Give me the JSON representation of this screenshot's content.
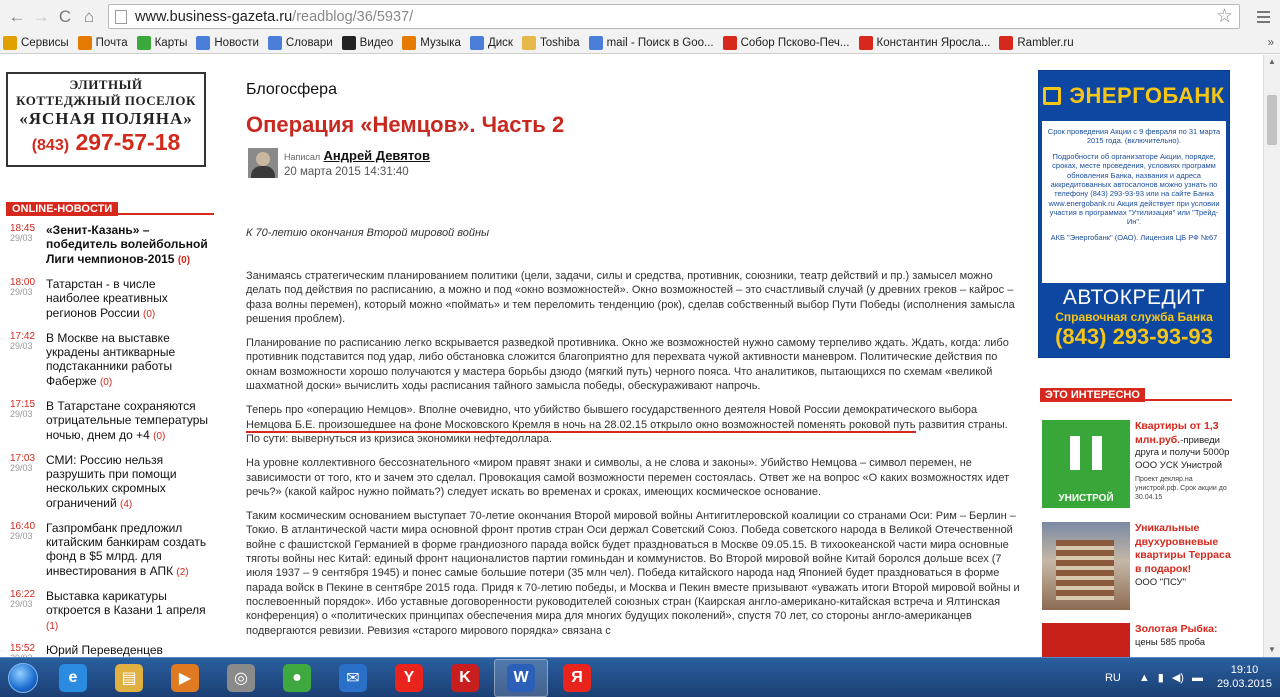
{
  "browser": {
    "url_host": "www.business-gazeta.ru",
    "url_path": "/readblog/36/5937/",
    "bookmarks": [
      {
        "label": "Сервисы",
        "icon": "apps-icon",
        "color": "#e0a000"
      },
      {
        "label": "Почта",
        "icon": "mail-ru-icon",
        "color": "#e57a00"
      },
      {
        "label": "Карты",
        "icon": "maps-icon",
        "color": "#3aa83a"
      },
      {
        "label": "Новости",
        "icon": "page-icon",
        "color": "#4a7ed8"
      },
      {
        "label": "Словари",
        "icon": "page-icon",
        "color": "#4a7ed8"
      },
      {
        "label": "Видео",
        "icon": "video-icon",
        "color": "#222222"
      },
      {
        "label": "Музыка",
        "icon": "music-icon",
        "color": "#e57a00"
      },
      {
        "label": "Диск",
        "icon": "disk-icon",
        "color": "#4a7ed8"
      },
      {
        "label": "Toshiba",
        "icon": "folder-icon",
        "color": "#e6b84a"
      },
      {
        "label": "mail - Поиск в Goo...",
        "icon": "google-icon",
        "color": "#4a7ed8"
      },
      {
        "label": "Собор Псково-Печ...",
        "icon": "yandex-icon",
        "color": "#d6281c"
      },
      {
        "label": "Константин Яросла...",
        "icon": "yandex-icon",
        "color": "#d6281c"
      },
      {
        "label": "Rambler.ru",
        "icon": "yandex-icon",
        "color": "#d6281c"
      }
    ],
    "bookmarks_more": "»"
  },
  "left": {
    "ad": {
      "line1": "ЭЛИТНЫЙ",
      "line2": "КОТТЕДЖНЫЙ ПОСЕЛОК",
      "line3": "«ЯСНАЯ ПОЛЯНА»",
      "phone_code": "(843)",
      "phone": "297-57-18"
    },
    "online_title": "ONLINE-НОВОСТИ",
    "news": [
      {
        "time": "18:45",
        "date": "29/03",
        "text": "«Зенит-Казань» – победитель волейбольной Лиги чемпионов-2015",
        "count": "(0)",
        "bold": true
      },
      {
        "time": "18:00",
        "date": "29/03",
        "text": "Татарстан - в числе наиболее креативных регионов России",
        "count": "(0)"
      },
      {
        "time": "17:42",
        "date": "29/03",
        "text": "В Москве на выставке украдены антикварные подстаканники работы Фаберже",
        "count": "(0)"
      },
      {
        "time": "17:15",
        "date": "29/03",
        "text": "В Татарстане сохраняются отрицательные температуры ночью, днем до +4",
        "count": "(0)"
      },
      {
        "time": "17:03",
        "date": "29/03",
        "text": "СМИ: Россию нельзя разрушить при помощи нескольких скромных ограничений",
        "count": "(4)"
      },
      {
        "time": "16:40",
        "date": "29/03",
        "text": "Газпромбанк предложил китайским банкирам создать фонд в $5 млрд. для инвестирования в АПК",
        "count": "(2)"
      },
      {
        "time": "16:22",
        "date": "29/03",
        "text": "Выставка карикатуры откроется в Казани 1 апреля",
        "count": "(1)"
      },
      {
        "time": "15:52",
        "date": "29/03",
        "text": "Юрий Переведенцев рассказал, чем грозит",
        "count": ""
      }
    ]
  },
  "article": {
    "rubric": "Блогосфера",
    "title": "Операция «Немцов». Часть 2",
    "wrote_label": "Написал",
    "author": "Андрей Девятов",
    "date": "20 марта 2015 14:31:40",
    "epigraph": "К 70-летию окончания Второй мировой войны",
    "p1": "Занимаясь стратегическим планированием политики (цели, задачи, силы и средства, противник, союзники, театр действий и пр.) замысел можно делать под действия по расписанию, а можно и под «окно возможностей». Окно возможностей – это счастливый случай (у древних греков – кайрос – фаза волны перемен), который можно «поймать» и тем переломить тенденцию (рок), сделав собственный выбор Пути Победы (исполнения замысла решения проблем).",
    "p2": "Планирование по расписанию легко вскрывается разведкой противника. Окно же возможностей нужно самому терпеливо ждать. Ждать, когда: либо противник подставится под удар, либо обстановка сложится благоприятно для перехвата чужой активности маневром. Политические действия по окнам возможности хорошо получаются у мастера борьбы дзюдо (мягкий путь) черного пояса. Что аналитиков, пытающихся по схемам «великой шахматной доски» вычислить ходы расписания тайного замысла победы, обескураживают напрочь.",
    "p3a": "Теперь про «операцию Немцов». Вполне очевидно, что убийство бывшего государственного деятеля Новой России демократического выбора ",
    "p3b": "Немцова Б.Е. произошедшее на фоне Московского Кремля в ночь на 28.02.15 открыло окно возможностей поменять роковой путь",
    "p3c": " развития страны. По сути: вывернуться из кризиса экономики нефтедоллара.",
    "p4": "На уровне коллективного бессознательного «миром правят знаки и символы, а не слова и законы». Убийство Немцова – символ перемен, не зависимости от того, кто и зачем это сделал. Провокация самой возможности перемен состоялась. Ответ же на вопрос «О каких возможностях идет речь?» (какой кайрос нужно поймать?) следует искать во временах и сроках, имеющих космическое основание.",
    "p5": "Таким космическим основанием выступает 70-летие окончания Второй мировой войны Антигитлеровской коалиции со странами Оси: Рим – Берлин – Токио. В атлантической части мира основной фронт против стран Оси держал Советский Союз. Победа советского народа в Великой Отечественной войне с фашистской Германией в форме грандиозного парада войск будет праздноваться в Москве 09.05.15. В тихоокеанской части мира основные тяготы войны нес Китай: единый фронт националистов партии гоминьдан и коммунистов. Во Второй мировой войне Китай боролся дольше всех (7 июля 1937 – 9 сентября 1945) и понес самые большие потери (35 млн чел). Победа китайского народа над Японией будет праздноваться в форме парада войск в Пекине в сентябре 2015 года. Придя к 70-летию победы, и Москва и Пекин вместе призывают «уважать итоги Второй мировой войны и послевоенный порядок». Ибо уставные договоренности руководителей союзных стран (Каирская англо-американо-китайская встреча и Ялтинская конференция) о «политических принципах обеспечения мира для многих будущих поколений», спустя 70 лет, со стороны англо-американцев подвергаются ревизии. Ревизия «старого мирового порядка» связана с"
  },
  "right": {
    "bank_name": "ЭНЕРГОБАНК",
    "bank_text_1": "Срок проведения Акции с 9 февраля по 31 марта 2015 года. (включительно).",
    "bank_text_2": "Подробности об организаторе Акции, порядке, сроках, месте проведения, условиях программ обновления Банка, названия и адреса аккредитованных автосалонов можно узнать по телефону (843) 293-93-93 или на сайте Банка www.energobank.ru Акция действует при условии участия в программах \"Утилизация\" или \"Трейд-Ин\".",
    "bank_text_3": "АКБ \"Энергобанк\" (ОАО). Лицензия ЦБ РФ №67",
    "avto": "АВТОКРЕДИТ",
    "help": "Справочная служба Банка",
    "phone": "(843) 293-93-93",
    "interesting_title": "ЭТО ИНТЕРЕСНО",
    "promo1": {
      "pic_label": "УНИСТРОЙ",
      "red": "Квартиры от 1,3 млн.руб.",
      "text": "-приведи друга и получи 5000р ООО УСК Унистрой",
      "small": "Проект декляр.на унистрой.рф. Срок акции до 30.04.15"
    },
    "promo2": {
      "red": "Уникальные двухуровневые квартиры Терраса в подарок!",
      "text": "ООО \"ПСУ\""
    },
    "promo3": {
      "red": "Золотая Рыбка:",
      "text": "цены 585 проба"
    }
  },
  "taskbar": {
    "apps": [
      {
        "name": "ie-icon",
        "label": "e",
        "color": "#2a8be0"
      },
      {
        "name": "explorer-icon",
        "label": "▤",
        "color": "#e0b040"
      },
      {
        "name": "media-player-icon",
        "label": "▶",
        "color": "#e07a20"
      },
      {
        "name": "settings-icon",
        "label": "◎",
        "color": "#8a8a8a"
      },
      {
        "name": "chrome-icon",
        "label": "●",
        "color": "#3fa83f"
      },
      {
        "name": "mail-icon",
        "label": "✉",
        "color": "#2a70c8"
      },
      {
        "name": "yandex-browser-icon",
        "label": "Y",
        "color": "#e8241c"
      },
      {
        "name": "kaspersky-icon",
        "label": "K",
        "color": "#c81e1e"
      },
      {
        "name": "word-icon",
        "label": "W",
        "color": "#2b5fb8"
      },
      {
        "name": "yandex-icon",
        "label": "Я",
        "color": "#e8241c"
      }
    ],
    "lang": "RU",
    "time": "19:10",
    "date": "29.03.2015"
  }
}
